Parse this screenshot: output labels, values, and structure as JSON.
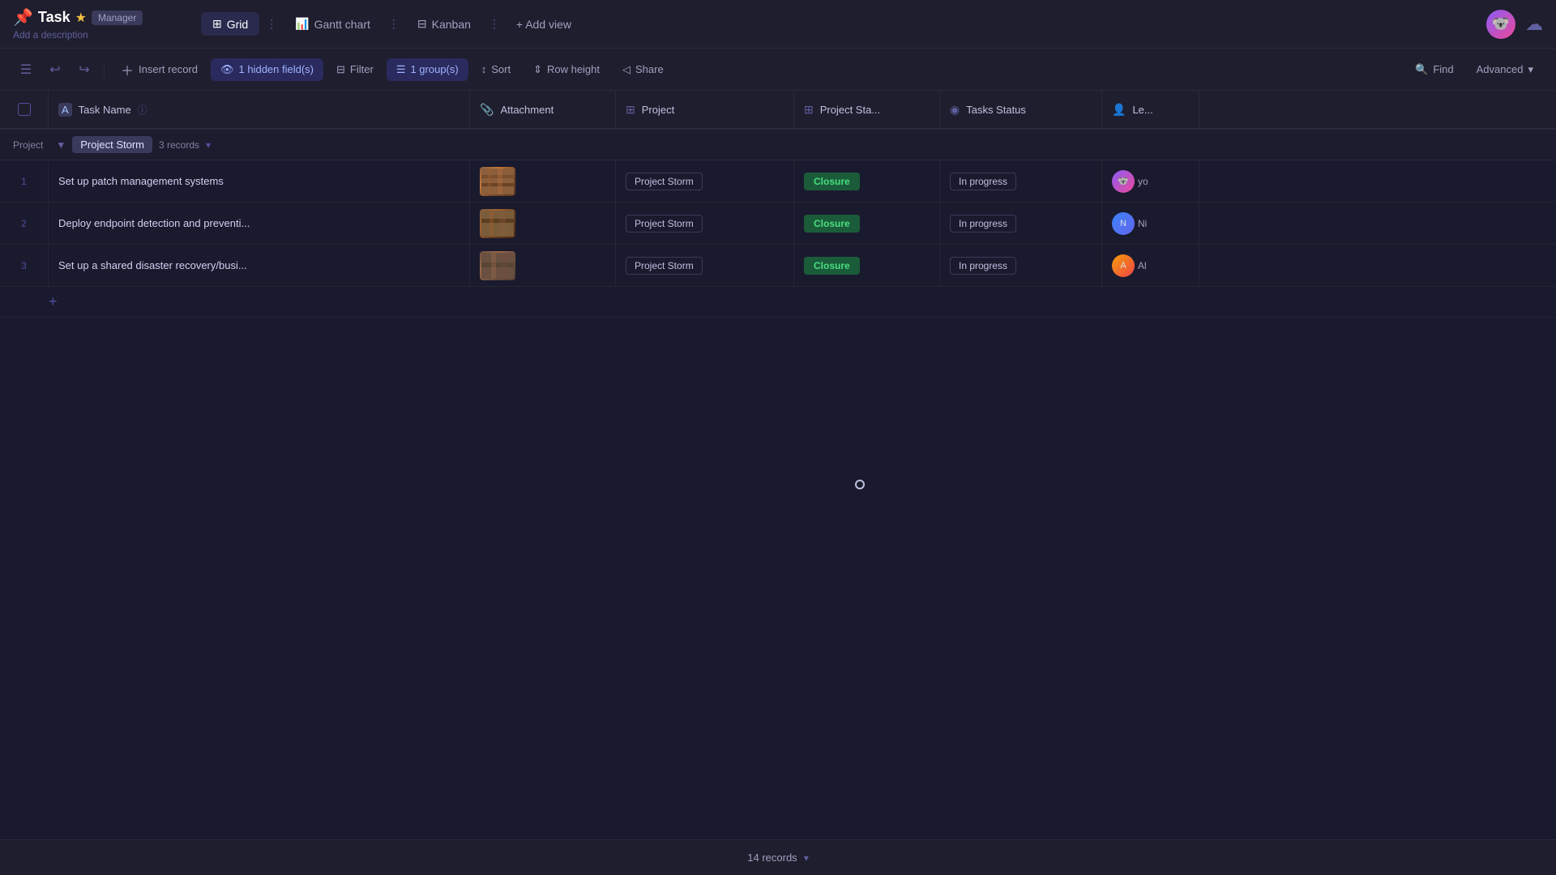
{
  "appBar": {
    "title": "Task",
    "badge": "Manager",
    "description": "Add a description",
    "views": [
      {
        "id": "grid",
        "label": "Grid",
        "active": true,
        "icon": "⊞"
      },
      {
        "id": "gantt",
        "label": "Gantt chart",
        "active": false,
        "icon": "📊"
      },
      {
        "id": "kanban",
        "label": "Kanban",
        "active": false,
        "icon": "⊟"
      }
    ],
    "addViewLabel": "+ Add view"
  },
  "toolbar": {
    "insertRecord": "Insert record",
    "hiddenFields": "1 hidden field(s)",
    "filter": "Filter",
    "groups": "1 group(s)",
    "sort": "Sort",
    "rowHeight": "Row height",
    "share": "Share",
    "find": "Find",
    "advanced": "Advanced"
  },
  "columns": [
    {
      "id": "task-name",
      "label": "Task Name",
      "icon": "A"
    },
    {
      "id": "attachment",
      "label": "Attachment",
      "icon": "📎"
    },
    {
      "id": "project",
      "label": "Project",
      "icon": "⊞"
    },
    {
      "id": "project-status",
      "label": "Project Sta...",
      "icon": "⊞"
    },
    {
      "id": "tasks-status",
      "label": "Tasks Status",
      "icon": "◉"
    },
    {
      "id": "lead",
      "label": "Le...",
      "icon": "👤"
    }
  ],
  "groupLabel": "Project",
  "groupValue": "Project Storm",
  "groupCount": "3 records",
  "rows": [
    {
      "num": "1",
      "taskName": "Set up patch management systems",
      "project": "Project Storm",
      "projectStatus": "Closure",
      "tasksStatus": "In progress"
    },
    {
      "num": "2",
      "taskName": "Deploy endpoint detection and preventi...",
      "project": "Project Storm",
      "projectStatus": "Closure",
      "tasksStatus": "In progress"
    },
    {
      "num": "3",
      "taskName": "Set up a shared disaster recovery/busi...",
      "project": "Project Storm",
      "projectStatus": "Closure",
      "tasksStatus": "In progress"
    }
  ],
  "bottomBar": {
    "recordsCount": "14 records"
  },
  "colors": {
    "accent": "#6060ff",
    "closureBg": "#1a5c3a",
    "closureText": "#4ade80"
  }
}
